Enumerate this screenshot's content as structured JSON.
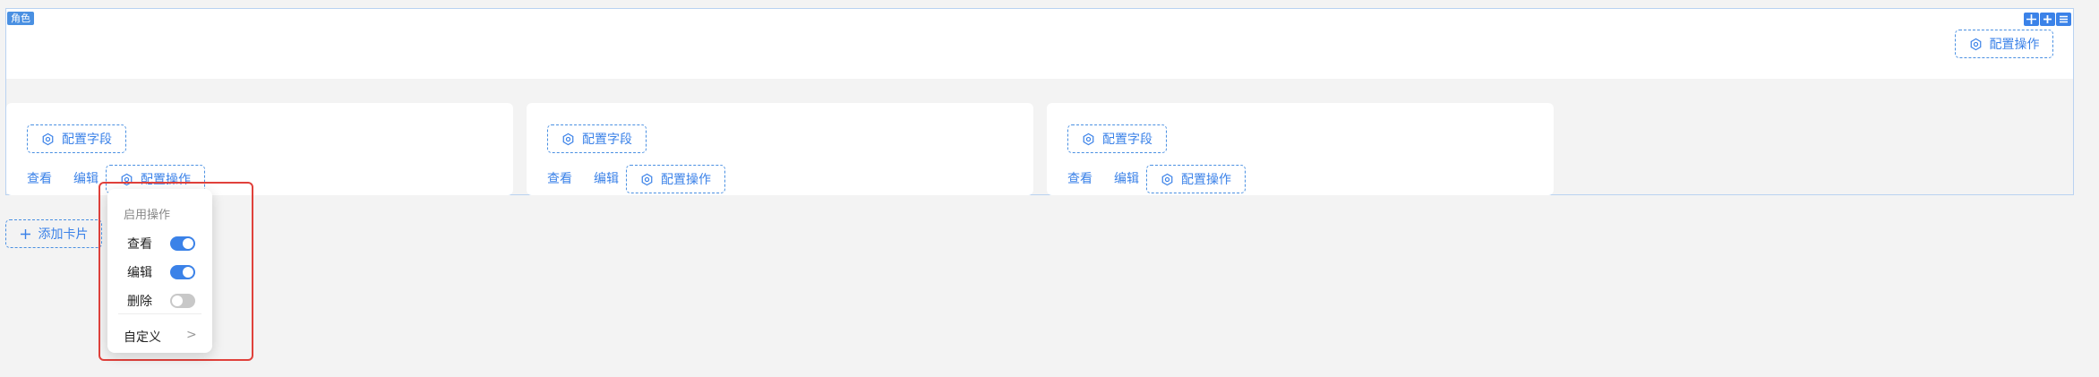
{
  "block": {
    "tag": "角色",
    "toolbar": [
      "drag-icon",
      "add-icon",
      "menu-icon"
    ],
    "configure_actions_label": "配置操作"
  },
  "cards": [
    {
      "configure_fields_label": "配置字段",
      "view_label": "查看",
      "edit_label": "编辑",
      "configure_actions_label": "配置操作"
    },
    {
      "configure_fields_label": "配置字段",
      "view_label": "查看",
      "edit_label": "编辑",
      "configure_actions_label": "配置操作"
    },
    {
      "configure_fields_label": "配置字段",
      "view_label": "查看",
      "edit_label": "编辑",
      "configure_actions_label": "配置操作"
    }
  ],
  "add_card_label": "添加卡片",
  "popover": {
    "title": "启用操作",
    "items": [
      {
        "label": "查看",
        "enabled": true
      },
      {
        "label": "编辑",
        "enabled": true
      },
      {
        "label": "删除",
        "enabled": false
      }
    ],
    "custom_label": "自定义",
    "custom_chevron": ">"
  },
  "colors": {
    "accent": "#3b82e8",
    "highlight": "#e0413b",
    "switch_off": "#c8c8c8"
  }
}
